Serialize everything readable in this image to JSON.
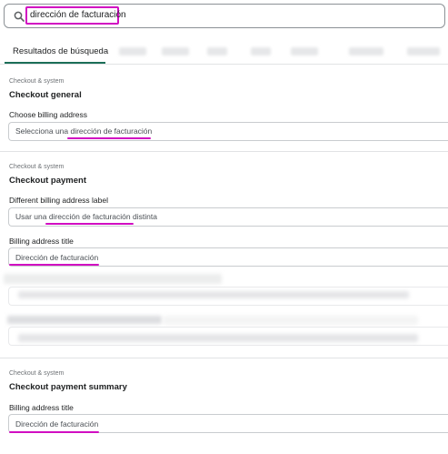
{
  "search": {
    "query": "dirección de facturación"
  },
  "tabs": {
    "active_label": "Resultados de búsqueda"
  },
  "sections": [
    {
      "label": "Checkout & system",
      "title": "Checkout general",
      "fields": [
        {
          "label": "Choose billing address",
          "value": "Selecciona una dirección de facturación"
        }
      ]
    },
    {
      "label": "Checkout & system",
      "title": "Checkout payment",
      "fields": [
        {
          "label": "Different billing address label",
          "value": "Usar una dirección de facturación distinta"
        },
        {
          "label": "Billing address title",
          "value": "Dirección de facturación"
        }
      ]
    },
    {
      "label": "Checkout & system",
      "title": "Checkout payment summary",
      "fields": [
        {
          "label": "Billing address title",
          "value": "Dirección de facturación"
        }
      ]
    }
  ],
  "colors": {
    "highlight": "#d10ec2",
    "tab_accent": "#1c6e58"
  },
  "icons": [
    "search-icon"
  ]
}
